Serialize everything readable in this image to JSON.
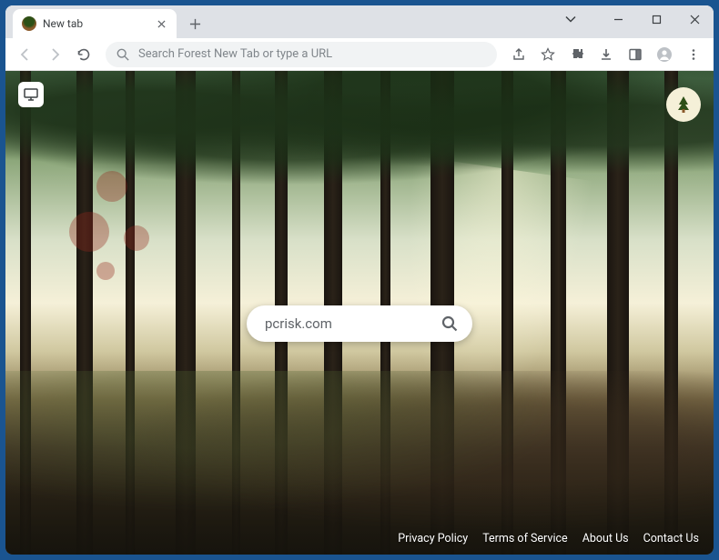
{
  "tab": {
    "title": "New tab"
  },
  "omnibox": {
    "placeholder": "Search Forest New Tab or type a URL"
  },
  "page": {
    "search_value": "pcrisk.com",
    "footer_links": [
      "Privacy Policy",
      "Terms of Service",
      "About Us",
      "Contact Us"
    ]
  }
}
